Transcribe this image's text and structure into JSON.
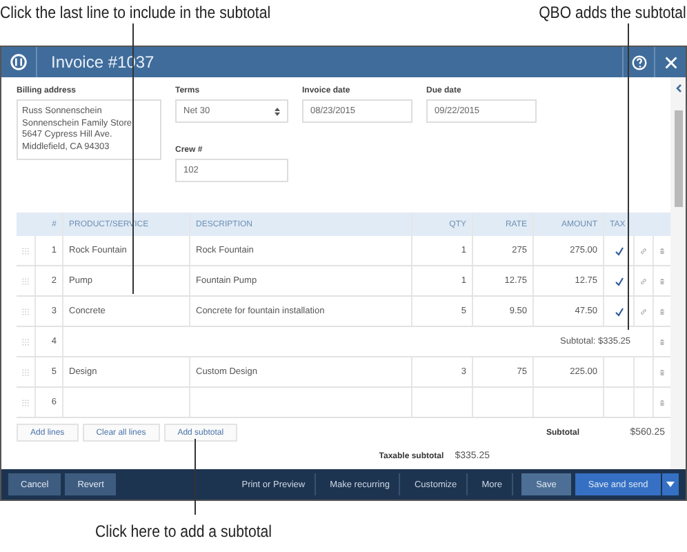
{
  "annotations": {
    "top_left": "Click the last line to include in the subtotal",
    "top_right": "QBO adds the subtotal",
    "bottom": "Click here to add a subtotal"
  },
  "window": {
    "title": "Invoice #1037"
  },
  "billing": {
    "label": "Billing address",
    "lines": [
      "Russ Sonnenschein",
      "Sonnenschein Family Store",
      "5647 Cypress Hill Ave.",
      "Middlefield, CA  94303"
    ]
  },
  "terms": {
    "label": "Terms",
    "value": "Net 30"
  },
  "invoice_date": {
    "label": "Invoice date",
    "value": "08/23/2015"
  },
  "due_date": {
    "label": "Due date",
    "value": "09/22/2015"
  },
  "crew": {
    "label": "Crew #",
    "value": "102"
  },
  "table": {
    "columns": [
      "#",
      "PRODUCT/SERVICE",
      "DESCRIPTION",
      "QTY",
      "RATE",
      "AMOUNT",
      "TAX"
    ],
    "rows": [
      {
        "kind": "item",
        "num": "1",
        "product": "Rock Fountain",
        "description": "Rock Fountain",
        "qty": "1",
        "rate": "275",
        "amount": "275.00",
        "taxable": true,
        "linked": true
      },
      {
        "kind": "item",
        "num": "2",
        "product": "Pump",
        "description": "Fountain Pump",
        "qty": "1",
        "rate": "12.75",
        "amount": "12.75",
        "taxable": true,
        "linked": true
      },
      {
        "kind": "item",
        "num": "3",
        "product": "Concrete",
        "description": "Concrete for fountain installation",
        "qty": "5",
        "rate": "9.50",
        "amount": "47.50",
        "taxable": true,
        "linked": true
      },
      {
        "kind": "subtotal",
        "num": "4",
        "text": "Subtotal: $335.25"
      },
      {
        "kind": "item",
        "num": "5",
        "product": "Design",
        "description": "Custom Design",
        "qty": "3",
        "rate": "75",
        "amount": "225.00",
        "taxable": false,
        "linked": false
      },
      {
        "kind": "item",
        "num": "6",
        "taxable": false,
        "linked": false
      }
    ]
  },
  "line_buttons": [
    "Add lines",
    "Clear all lines",
    "Add subtotal"
  ],
  "totals": {
    "subtotal_label": "Subtotal",
    "subtotal_value": "$560.25",
    "taxable_label": "Taxable subtotal",
    "taxable_value": "$335.25"
  },
  "footer": [
    {
      "kind": "secondary",
      "label": "Cancel"
    },
    {
      "kind": "secondary",
      "label": "Revert"
    },
    {
      "kind": "link",
      "label": "Print or Preview"
    },
    {
      "kind": "link",
      "label": "Make recurring"
    },
    {
      "kind": "link",
      "label": "Customize"
    },
    {
      "kind": "link",
      "label": "More"
    },
    {
      "kind": "save",
      "label": "Save"
    },
    {
      "kind": "primary",
      "label": "Save and send"
    }
  ]
}
